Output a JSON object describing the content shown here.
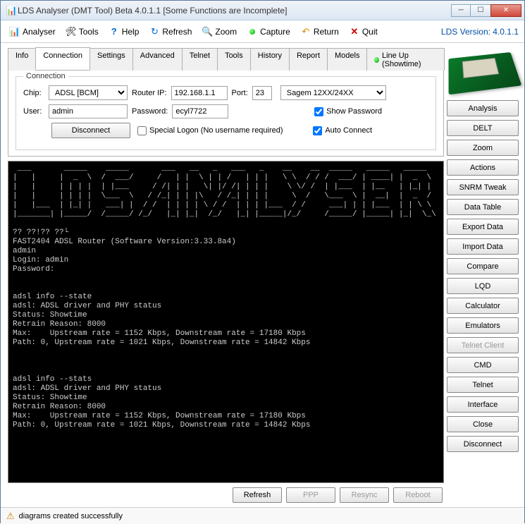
{
  "window": {
    "title": "LDS Analyser (DMT Tool) Beta 4.0.1.1 [Some Functions are Incomplete]"
  },
  "toolbar": {
    "analyser": "Analyser",
    "tools": "Tools",
    "help": "Help",
    "refresh": "Refresh",
    "zoom": "Zoom",
    "capture": "Capture",
    "return": "Return",
    "quit": "Quit",
    "version": "LDS Version: 4.0.1.1"
  },
  "tabs": {
    "info": "Info",
    "connection": "Connection",
    "settings": "Settings",
    "advanced": "Advanced",
    "telnet": "Telnet",
    "tools": "Tools",
    "history": "History",
    "report": "Report",
    "models": "Models",
    "lineup": "Line Up (Showtime)"
  },
  "conn": {
    "legend": "Connection",
    "chip_label": "Chip:",
    "chip_value": "ADSL [BCM]",
    "routerip_label": "Router IP:",
    "routerip_value": "192.168.1.1",
    "port_label": "Port:",
    "port_value": "23",
    "modem_value": "Sagem 12XX/24XX",
    "user_label": "User:",
    "user_value": "admin",
    "password_label": "Password:",
    "password_value": "ecyl7722",
    "showpw_label": "Show Password",
    "disconnect": "Disconnect",
    "special_label": "Special Logon (No username required)",
    "autoconn_label": "Auto Connect"
  },
  "terminal_text": " ___       _____    _____       ___   __   _   ___   _    __    __  _____   _____   _____\n|   |     |  _  \\  /  ___/     /   | |  \\ | | /   | | |   \\ \\  / / /  ___/ | ____| |  _  \\\n|   |     | | | |  | |___     / /| | |   \\| |/ /| | | |    \\ \\/ /  | |___  | |__   | |_| |\n|   |     | | | |  \\___  \\   / /_| | | |\\   / /_| | | |     \\  /   \\___  \\ |  __|  |  _  /\n|   |___  | |_| |   ___| |  / /  | | | | \\ / /  | | | |___  / /     ___| | | |___  | | \\ \\\n|_______| |_____/  /_____/ /_/   |_| |_|  /_/   |_| |_____|/_/     /_____/ |_____| |_|  \\_\\\n\n?? ??!?? ??└\nFAST2404 ADSL Router (Software Version:3.33.8a4)\nadmin\nLogin: admin\nPassword:\n\n\nadsl info --state\nadsl: ADSL driver and PHY status\nStatus: Showtime\nRetrain Reason: 8000\nMax:    Upstream rate = 1152 Kbps, Downstream rate = 17180 Kbps\nPath: 0, Upstream rate = 1021 Kbps, Downstream rate = 14842 Kbps\n\n\n\nadsl info --stats\nadsl: ADSL driver and PHY status\nStatus: Showtime\nRetrain Reason: 8000\nMax:    Upstream rate = 1152 Kbps, Downstream rate = 17180 Kbps\nPath: 0, Upstream rate = 1021 Kbps, Downstream rate = 14842 Kbps",
  "bottombar": {
    "refresh": "Refresh",
    "ppp": "PPP",
    "resync": "Resync",
    "reboot": "Reboot"
  },
  "sidebar": {
    "analysis": "Analysis",
    "delt": "DELT",
    "zoom": "Zoom",
    "actions": "Actions",
    "snrm": "SNRM Tweak",
    "datatable": "Data Table",
    "export": "Export Data",
    "import": "Import Data",
    "compare": "Compare",
    "lqd": "LQD",
    "calculator": "Calculator",
    "emulators": "Emulators",
    "telnetclient": "Telnet Client",
    "cmd": "CMD",
    "telnet": "Telnet",
    "interface": "Interface",
    "close": "Close",
    "disconnect": "Disconnect"
  },
  "status": {
    "text": "diagrams created successfully"
  }
}
